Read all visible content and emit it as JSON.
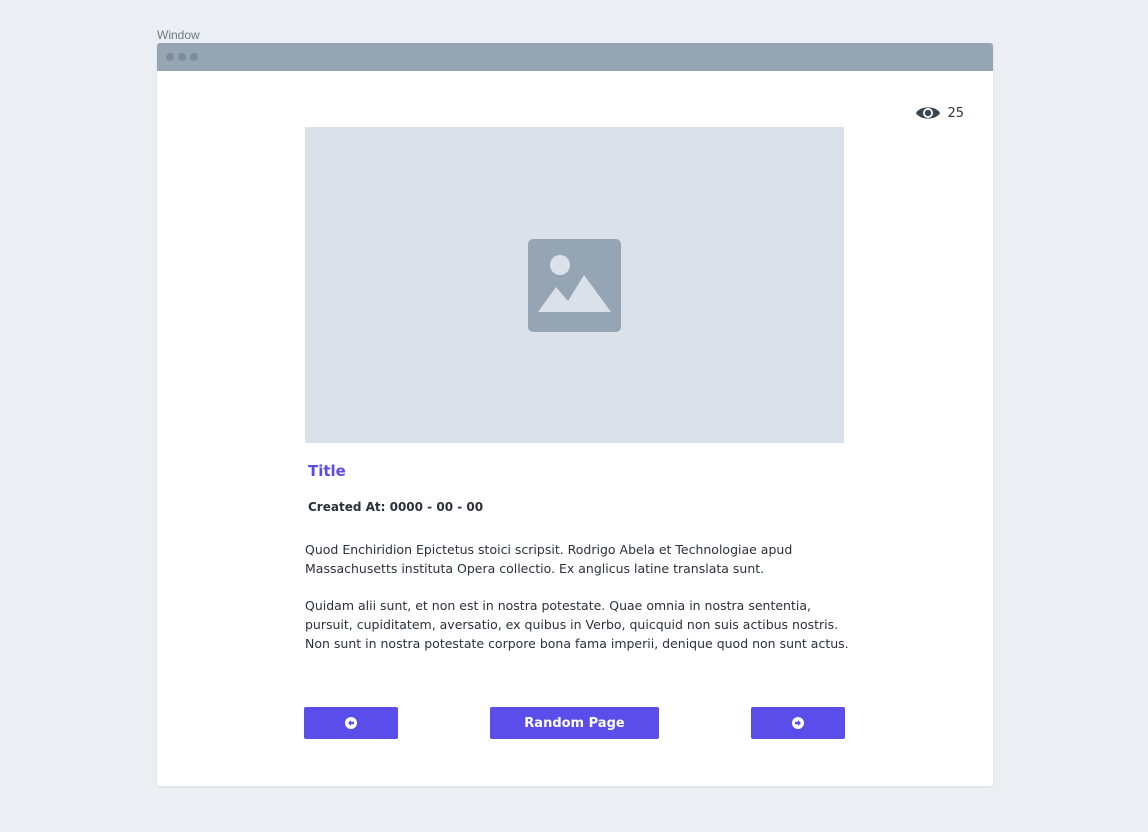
{
  "window": {
    "label": "Window"
  },
  "views": {
    "icon": "eye-icon",
    "count": "25"
  },
  "hero": {
    "icon": "image-placeholder-icon"
  },
  "post": {
    "title": "Title",
    "created_at": "Created At: 0000 - 00 - 00",
    "paragraphs": [
      "Quod Enchiridion Epictetus stoici scripsit. Rodrigo Abela et Technologiae apud Massachusetts instituta Opera collectio. Ex anglicus latine translata sunt.",
      "Quidam alii sunt, et non est in nostra potestate. Quae omnia in nostra sententia, pursuit, cupiditatem, aversatio, ex quibus in Verbo, quicquid non suis actibus nostris. Non sunt in nostra potestate corpore bona fama imperii, denique quod non sunt actus."
    ]
  },
  "nav": {
    "prev_icon": "arrow-left-circle-icon",
    "random_label": "Random Page",
    "next_icon": "arrow-right-circle-icon"
  },
  "colors": {
    "accent": "#5b4de9",
    "titlebar": "#96a5b3",
    "placeholder": "#dae1e9",
    "background": "#ebeff4"
  }
}
